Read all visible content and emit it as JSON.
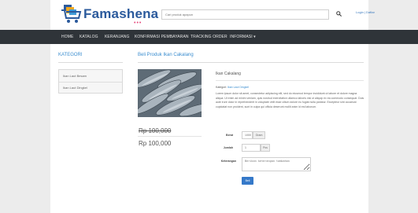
{
  "header": {
    "logo_text": "Famashena",
    "logo_dots": "•••",
    "search_placeholder": "Cari produk apapun",
    "login_link": "Login | Daftar"
  },
  "nav": {
    "items": [
      "HOME",
      "KATALOG",
      "KERANJANG",
      "KONFIRMASI PEMBAYARAN",
      "TRACKING ORDER",
      "INFORMASI ▾"
    ]
  },
  "sidebar": {
    "title": "KATEGORI",
    "items": [
      "Ikan Laut Besam",
      "Ikan Laut Dingkel"
    ]
  },
  "main": {
    "title": "Beli Produk Ikan Cakalang",
    "old_price": "Rp 100,000",
    "new_price": "Rp 100,000",
    "product_name": "Ikan Cakalang",
    "kategori_label": "Kategori:",
    "kategori_value": "Ikan Laut Dingkel",
    "description": "Lorem ipsum dolor sit amet, consectetur adipiscing elit, sed do eiusmod tempor incididunt ut labore et dolore magna aliqua. Ut enim ad minim veniam, quis nostrud exercitation ullamco laboris nisi ut aliquip ex ea commodo consequat. Duis aute irure dolor in reprehenderit in voluptate velit esse cillum dolore eu fugiat nulla pariatur. Excepteur sint occaecat cupidatat non proident, sunt in culpa qui officia deserunt mollit anim id est laborum."
  },
  "form": {
    "berat_label": "Berat",
    "berat_value": "1000",
    "berat_unit": "Gram",
    "jumlah_label": "Jumlah",
    "jumlah_value": "1",
    "jumlah_unit": "Pcs",
    "keterangan_label": "Keterangan",
    "keterangan_placeholder": "Berikan keterangan tambahan",
    "submit_label": "Beli"
  },
  "colors": {
    "navbar": "#2f3439",
    "accent": "#3a8dcf",
    "button": "#3579c9"
  },
  "icons": {
    "logo": "shopping-cart-icon",
    "search": "search-icon"
  }
}
